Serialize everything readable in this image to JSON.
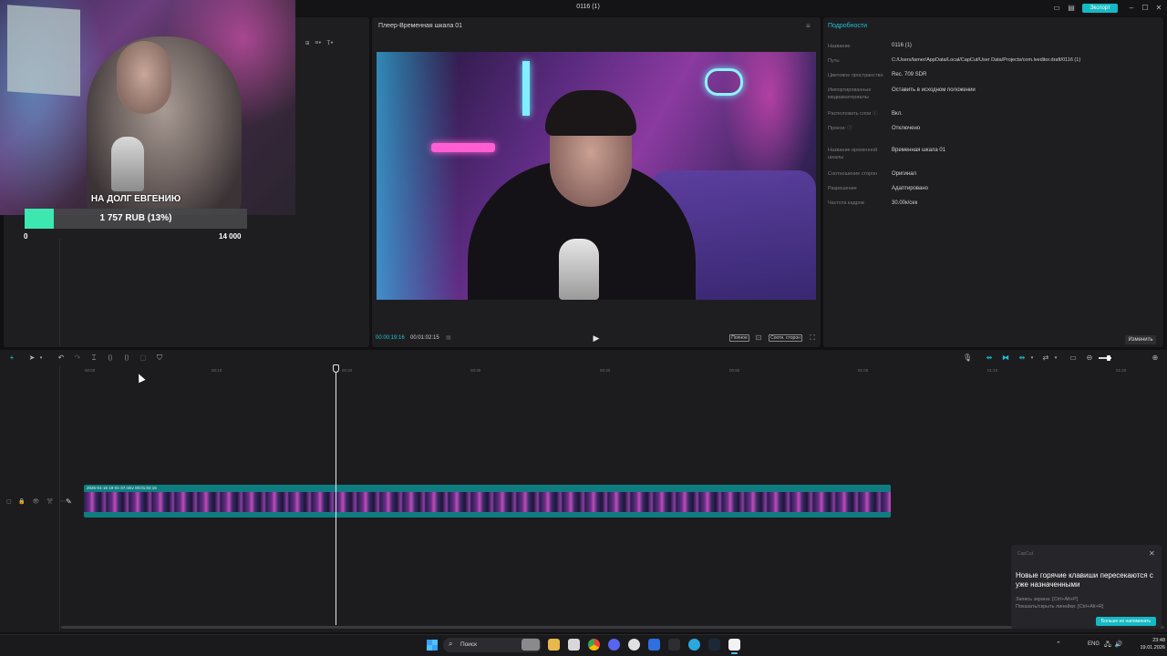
{
  "window": {
    "title": "0116 (1)",
    "export_label": "Экспорт"
  },
  "overlay": {
    "donation_title": "НА ДОЛГ ЕВГЕНИЮ",
    "amount": "1 757 RUB (13%)",
    "progress_fraction": 0.13,
    "min": "0",
    "max": "14 000"
  },
  "player": {
    "title": "Плеер-Временная шкала 01",
    "current_time": "00:00:19:16",
    "total_time": "00:01:02:15",
    "full_label": "Полное",
    "ratio_label": "Соотн. сторон"
  },
  "details": {
    "tab": "Подробности",
    "rows": [
      {
        "label": "Название",
        "value": "0116 (1)"
      },
      {
        "label": "Путь:",
        "value": "C:/Users/lamer/AppData/Local/CapCut/User Data/Projects/com.lveditor.draft/0116 (1)"
      },
      {
        "label": "Цветовое пространство",
        "value": "Rec. 709 SDR"
      },
      {
        "label": "Импортированные медиаматериалы",
        "value": "Оставить в исходном положении"
      },
      {
        "label": "Расположить слои ⓘ",
        "value": "Вкл."
      },
      {
        "label": "Прокси: ⓘ",
        "value": "Отключено"
      },
      {
        "label": "Название временной шкалы",
        "value": "Временная шкала 01"
      },
      {
        "label": "Соотношение сторон",
        "value": "Оригинал"
      },
      {
        "label": "Разрешение",
        "value": "Адаптировано"
      },
      {
        "label": "Частота кадров",
        "value": "30.00к/сек"
      }
    ],
    "change_label": "Изменить"
  },
  "timeline": {
    "ruler": [
      "00:00",
      "00:10",
      "00:20",
      "00:30",
      "00:40",
      "00:50",
      "01:00",
      "01:10",
      "01:20"
    ],
    "clip_label": "2026-01-16 19-01-37.mkv   00:01:02:15"
  },
  "notification": {
    "app": "CapCut",
    "title": "Новые горячие клавиши пересекаются с уже назначенными",
    "line1": "Запись экрана: [Ctrl+Alt+P]",
    "line2": "Показать/скрыть линейки: [Ctrl+Alt+R]",
    "button": "Больше не напоминать"
  },
  "taskbar": {
    "search_label": "Поиск",
    "lang": "ENG",
    "time": "23:48",
    "date": "19.01.2026"
  },
  "colors": {
    "accent": "#1fc3cf",
    "donation_fill": "#3de8b0"
  }
}
